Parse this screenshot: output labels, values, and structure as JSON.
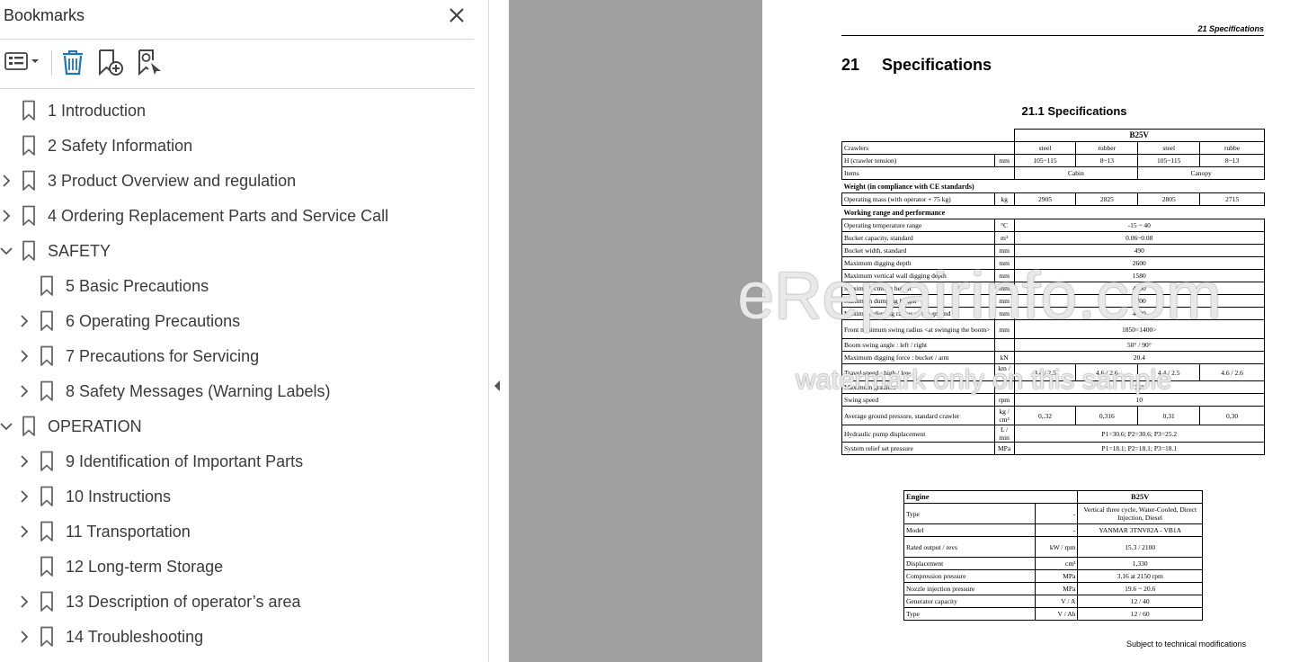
{
  "panel": {
    "title": "Bookmarks",
    "toolbar": {
      "options_icon": "list-options-icon",
      "delete_icon": "trash-icon",
      "add_icon": "bookmark-add-icon",
      "find_icon": "bookmark-find-icon"
    },
    "items": [
      {
        "label": "1 Introduction",
        "level": 0,
        "expandable": false,
        "expanded": false
      },
      {
        "label": "2 Safety Information",
        "level": 0,
        "expandable": false,
        "expanded": false
      },
      {
        "label": "3 Product Overview and regulation",
        "level": 0,
        "expandable": true,
        "expanded": false
      },
      {
        "label": "4 Ordering Replacement Parts and Service Call",
        "level": 0,
        "expandable": true,
        "expanded": false
      },
      {
        "label": "SAFETY",
        "level": 0,
        "expandable": true,
        "expanded": true
      },
      {
        "label": "5 Basic Precautions",
        "level": 1,
        "expandable": false,
        "expanded": false
      },
      {
        "label": "6 Operating Precautions",
        "level": 1,
        "expandable": true,
        "expanded": false
      },
      {
        "label": "7 Precautions for Servicing",
        "level": 1,
        "expandable": true,
        "expanded": false
      },
      {
        "label": "8 Safety Messages (Warning Labels)",
        "level": 1,
        "expandable": true,
        "expanded": false
      },
      {
        "label": "OPERATION",
        "level": 0,
        "expandable": true,
        "expanded": true
      },
      {
        "label": "9 Identification of Important Parts",
        "level": 1,
        "expandable": true,
        "expanded": false
      },
      {
        "label": "10 Instructions",
        "level": 1,
        "expandable": true,
        "expanded": false
      },
      {
        "label": "11 Transportation",
        "level": 1,
        "expandable": true,
        "expanded": false
      },
      {
        "label": "12 Long-term Storage",
        "level": 1,
        "expandable": false,
        "expanded": false
      },
      {
        "label": "13 Description of operator’s area",
        "level": 1,
        "expandable": true,
        "expanded": false
      },
      {
        "label": "14 Troubleshooting",
        "level": 1,
        "expandable": true,
        "expanded": false
      }
    ]
  },
  "document": {
    "running_head": "21 Specifications",
    "chapter_num": "21",
    "chapter_title": "Specifications",
    "section_title": "21.1  Specifications",
    "table1": {
      "model": "B25V",
      "crawlers_label": "Crawlers",
      "crawlers": [
        "steel",
        "rubber",
        "steel",
        "rubbe"
      ],
      "h_label": "H (crawler tension)",
      "h_unit": "mm",
      "h_values": [
        "105~115",
        "8~13",
        "105~115",
        "8~13"
      ],
      "items_label": "Items",
      "cabin": "Cabin",
      "canopy": "Canopy",
      "weight_section": "Weight (in compliance with CE standards)",
      "opmass_label": "Operating mass (with operator + 75 kg)",
      "opmass_unit": "kg",
      "opmass_values": [
        "2905",
        "2825",
        "2805",
        "2715"
      ],
      "working_section": "Working range and performance",
      "rows": [
        {
          "label": "Operating temperature range",
          "unit": "°C",
          "value": "-15 ~ 40"
        },
        {
          "label": "Bucket capacity, standard",
          "unit": "m³",
          "value": "0.06~0.08"
        },
        {
          "label": "Bucket width, standard",
          "unit": "mm",
          "value": "490"
        },
        {
          "label": "Maximum digging depth",
          "unit": "mm",
          "value": "2600"
        },
        {
          "label": "Maximum vertical wall digging depth",
          "unit": "mm",
          "value": "1580"
        },
        {
          "label": "Maximum cutting height",
          "unit": "mm",
          "value": "4100"
        },
        {
          "label": "Maximum dumping height",
          "unit": "mm",
          "value": "2700"
        },
        {
          "label": "Maximum digging radius of the ground",
          "unit": "mm",
          "value": "4480"
        },
        {
          "label": "Front minimum swing radius <at swinging the boom>",
          "unit": "mm",
          "value": "1850<1400>"
        },
        {
          "label": "Boom swing angle : left / right",
          "unit": "",
          "value": "50° / 90°"
        },
        {
          "label": "Maximum digging force : bucket / arm",
          "unit": "kN",
          "value": "20.4"
        }
      ],
      "travel_label": "Travel speed : high / low",
      "travel_unit": "km / h",
      "travel_values": [
        "4.4 / 2.5",
        "4.6 / 2.6",
        "4.4 / 2.5",
        "4.6 / 2.6"
      ],
      "gradient_label": "Maximum gradient",
      "gradient_value": "30°",
      "swing_label": "Swing speed",
      "swing_unit": "rpm",
      "swing_value": "10",
      "pressure_label": "Average ground pressure, standard crawler",
      "pressure_unit": "kg / cm²",
      "pressure_values": [
        "0,.32",
        "0,316",
        "0,31",
        "0,30"
      ],
      "pump_label": "Hydraulic pump displacement",
      "pump_unit": "L / min",
      "pump_value": "P1=30.6; P2=30.6; P3=25.2",
      "relief_label": "System relief set pressure",
      "relief_unit": "MPa",
      "relief_value": "P1=18.1; P2=18.1; P3=18.1"
    },
    "table2": {
      "header_label": "Engine",
      "header_model": "B25V",
      "rows": [
        {
          "label": "Type",
          "unit": "-",
          "value": "Vertical three cycle, Water-Cooled, Direct Injection, Diesel"
        },
        {
          "label": "Model",
          "unit": "-",
          "value": "YANMAR 3TNV82A - VB1A"
        },
        {
          "label": "Rated output / revs",
          "unit": "kW / rpm",
          "value": "15.3 / 2100"
        },
        {
          "label": "Displacement",
          "unit": "cm³",
          "value": "1,330"
        },
        {
          "label": "Compression pressure",
          "unit": "MPa",
          "value": "3,16 at 2150 rpm"
        },
        {
          "label": "Nozzle injection pressure",
          "unit": "MPa",
          "value": "19.6 ~ 20.6"
        },
        {
          "label": "Generator capacity",
          "unit": "V / A",
          "value": "12 / 40"
        },
        {
          "label": "Type",
          "unit": "V / Ah",
          "value": "12 / 60"
        }
      ]
    },
    "footer_note": "Subject to technical modifications",
    "watermark_main": "eRepairinfo.com",
    "watermark_sub": "watermark only on this sample"
  }
}
